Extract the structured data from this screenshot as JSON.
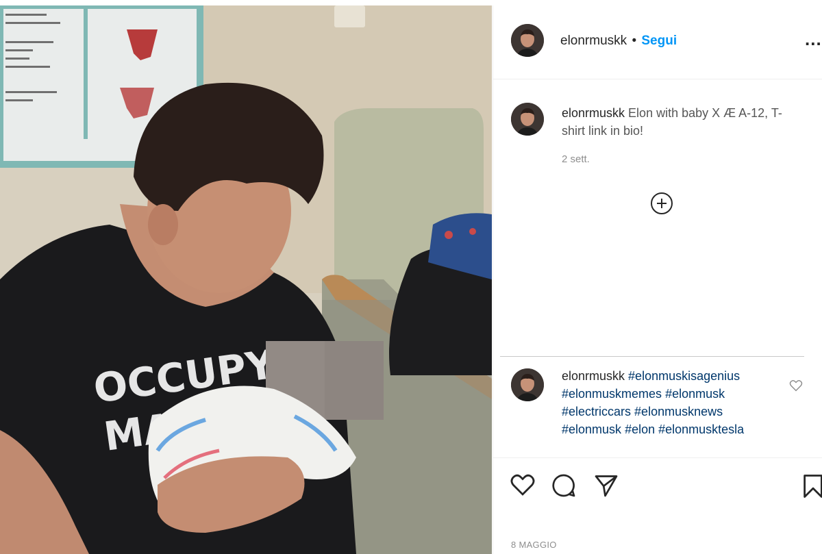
{
  "post": {
    "author": {
      "username": "elonrmuskk",
      "follow_label": "Segui",
      "separator": "•",
      "more_label": "..."
    },
    "caption": {
      "username": "elonrmuskk",
      "text": "Elon with baby X Æ A-12, T-shirt link in bio!",
      "time": "2 sett."
    },
    "comment": {
      "username": "elonrmuskk",
      "hashtags": [
        "#elonmuskisagenius",
        "#elonmuskmemes",
        "#elonmusk",
        "#electriccars",
        "#elonmusknews",
        "#elonmusk",
        "#elon",
        "#elonmusktesla"
      ]
    },
    "actions": {
      "like_icon": "heart-icon",
      "comment_icon": "comment-icon",
      "share_icon": "paper-plane-icon",
      "save_icon": "bookmark-icon"
    },
    "date": "8 MAGGIO",
    "photo": {
      "shirt_text_line1": "OCCUPY",
      "shirt_text_line2": "MARS"
    }
  },
  "colors": {
    "follow_blue": "#0095f6",
    "hashtag_blue": "#00376b",
    "meta_gray": "#8e8e8e"
  }
}
